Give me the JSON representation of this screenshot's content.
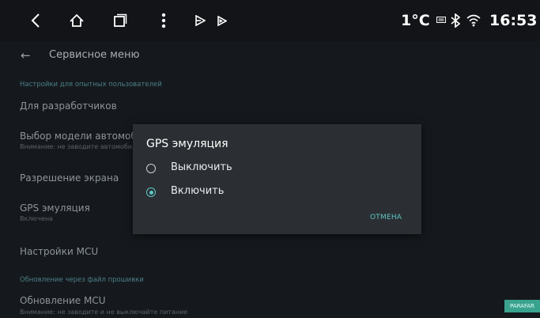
{
  "status_bar": {
    "nav_icons": [
      "back-icon",
      "home-icon",
      "recents-icon",
      "more-vert-icon",
      "media-icon-1",
      "media-icon-2"
    ],
    "temperature": "1°C",
    "time": "16:53"
  },
  "app_bar": {
    "back_icon": "←",
    "title": "Сервисное меню"
  },
  "settings": {
    "section_1": "Настройки для опытных пользователей",
    "developer": "Для разработчиков",
    "car_model": {
      "title": "Выбор модели автомобиля",
      "summary": "Внимание: не заводите автомобиль"
    },
    "resolution": "Разрешение экрана",
    "gps": {
      "title": "GPS эмуляция",
      "summary": "Включена"
    },
    "mcu_settings": "Настройки MCU",
    "section_2": "Обновление через файл прошивки",
    "mcu_update": {
      "title": "Обновление MCU",
      "summary": "Внимание: не заводите и не выключайте питание"
    }
  },
  "dialog": {
    "title": "GPS эмуляция",
    "options": [
      {
        "label": "Выключить",
        "selected": false
      },
      {
        "label": "Включить",
        "selected": true
      }
    ],
    "cancel_label": "ОТМЕНА"
  },
  "colors": {
    "accent": "#5ec7c4",
    "dialog_bg": "#2b2f33",
    "screen_bg": "#15191d"
  },
  "watermark": "PARAFAR"
}
